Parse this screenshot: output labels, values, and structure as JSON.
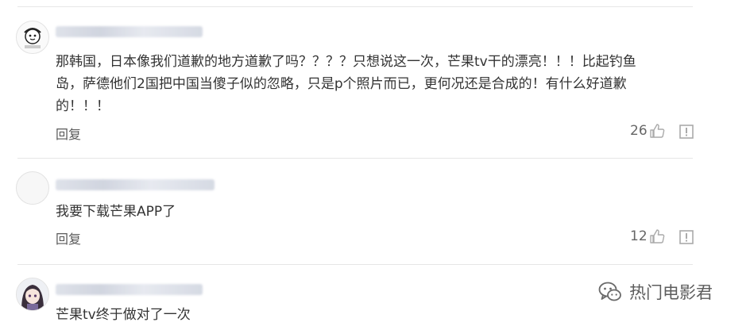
{
  "comments": [
    {
      "text": "那韩国，日本像我们道歉的地方道歉了吗？？？？只想说这一次，芒果tv干的漂亮！！！比起钓鱼\n岛，萨德他们2国把中国当傻子似的忽略，只是p个照片而已，更何况还是合成的！有什么好道歉\n的！！！",
      "reply_label": "回复",
      "likes": "26"
    },
    {
      "text": "我要下载芒果APP了",
      "reply_label": "回复",
      "likes": "12"
    },
    {
      "text": "芒果tv终于做对了一次"
    }
  ],
  "watermark": {
    "text": "热门电影君"
  },
  "colors": {
    "text": "#333333",
    "muted": "#666666",
    "divider": "#e6e6e6"
  },
  "icons": [
    "thumbs-up-icon",
    "report-icon",
    "wechat-icon"
  ]
}
